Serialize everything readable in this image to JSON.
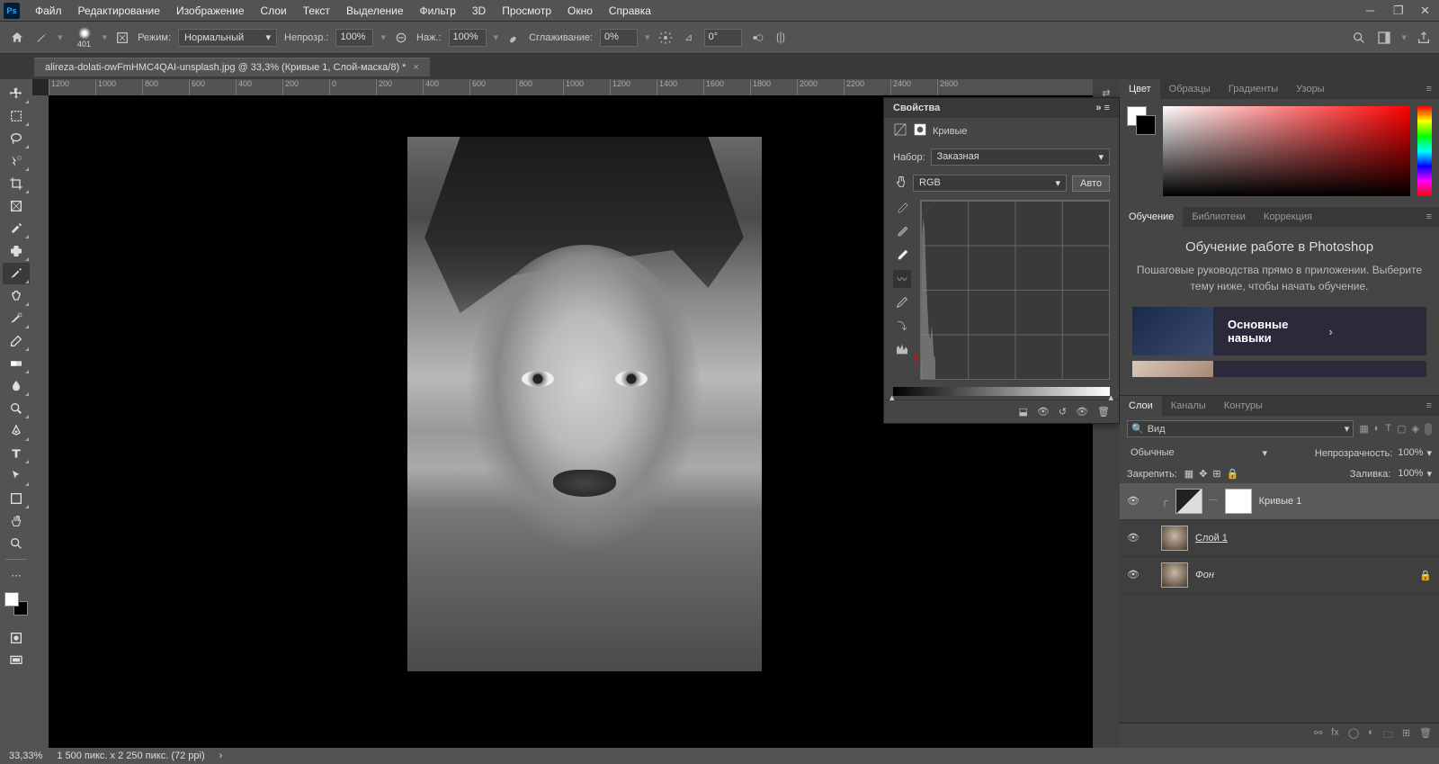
{
  "menu": {
    "items": [
      "Файл",
      "Редактирование",
      "Изображение",
      "Слои",
      "Текст",
      "Выделение",
      "Фильтр",
      "3D",
      "Просмотр",
      "Окно",
      "Справка"
    ]
  },
  "optbar": {
    "brush_size": "401",
    "mode_label": "Режим:",
    "mode_value": "Нормальный",
    "opacity_label": "Непрозр.:",
    "opacity_value": "100%",
    "flow_label": "Наж.:",
    "flow_value": "100%",
    "smooth_label": "Сглаживание:",
    "smooth_value": "0%",
    "angle": "0°"
  },
  "doc": {
    "tab": "alireza-dolati-owFmHMC4QAI-unsplash.jpg @ 33,3% (Кривые 1, Слой-маска/8) *"
  },
  "ruler": [
    "1200",
    "1000",
    "800",
    "600",
    "400",
    "200",
    "0",
    "200",
    "400",
    "600",
    "800",
    "1000",
    "1200",
    "1400",
    "1600",
    "1800",
    "2000",
    "2200",
    "2400",
    "2600"
  ],
  "props": {
    "title": "Свойства",
    "type": "Кривые",
    "preset_label": "Набор:",
    "preset_value": "Заказная",
    "channel": "RGB",
    "auto": "Авто"
  },
  "color_tabs": [
    "Цвет",
    "Образцы",
    "Градиенты",
    "Узоры"
  ],
  "learn_tabs": [
    "Обучение",
    "Библиотеки",
    "Коррекция"
  ],
  "learn": {
    "title": "Обучение работе в Photoshop",
    "desc": "Пошаговые руководства прямо в приложении. Выберите тему ниже, чтобы начать обучение.",
    "card1": "Основные навыки"
  },
  "layer_tabs": [
    "Слои",
    "Каналы",
    "Контуры"
  ],
  "layers": {
    "search": "Вид",
    "blend": "Обычные",
    "opacity_label": "Непрозрачность:",
    "opacity": "100%",
    "lock_label": "Закрепить:",
    "fill_label": "Заливка:",
    "fill": "100%",
    "items": [
      {
        "name": "Кривые 1",
        "adj": true,
        "mask": true
      },
      {
        "name": "Слой 1",
        "underline": true
      },
      {
        "name": "Фон",
        "locked": true,
        "italic": true
      }
    ]
  },
  "status": {
    "zoom": "33,33%",
    "dims": "1 500 пикс. x 2 250 пикс. (72 ppi)"
  }
}
